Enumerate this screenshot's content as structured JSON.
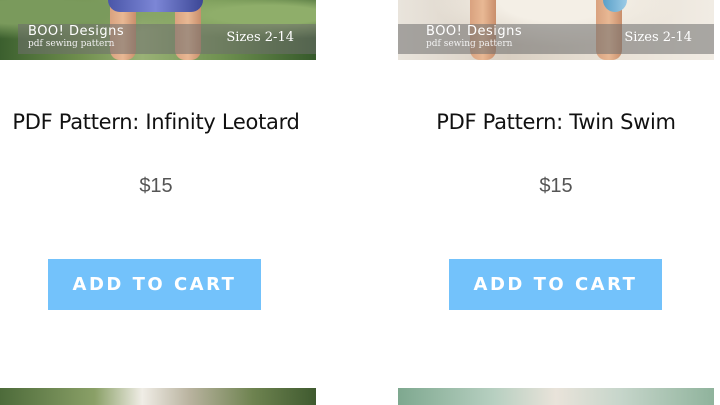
{
  "products": [
    {
      "title": "PDF Pattern: Infinity Leotard",
      "price": "$15",
      "button_label": "ADD TO CART",
      "image": {
        "brand": "BOO! Designs",
        "subtitle": "pdf sewing pattern",
        "sizes": "Sizes 2-14"
      }
    },
    {
      "title": "PDF Pattern: Twin Swim",
      "price": "$15",
      "button_label": "ADD TO CART",
      "image": {
        "brand": "BOO! Designs",
        "subtitle": "pdf sewing pattern",
        "sizes": "Sizes 2-14"
      }
    }
  ],
  "colors": {
    "button_bg": "#73c2fb",
    "button_text": "#ffffff",
    "title_text": "#111111",
    "price_text": "#555555"
  }
}
